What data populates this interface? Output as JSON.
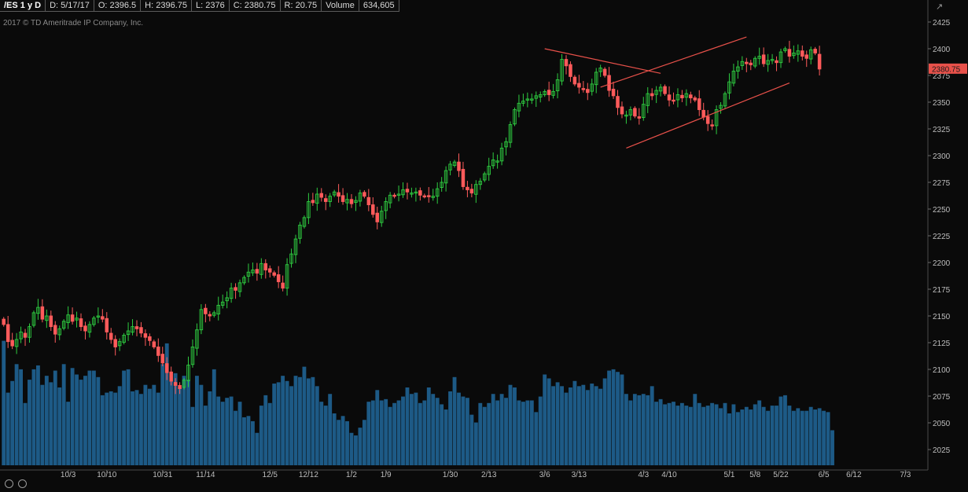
{
  "header": {
    "symbol": "/ES 1 y D",
    "date": "D: 5/17/17",
    "open": "O: 2396.5",
    "high": "H: 2396.75",
    "low": "L: 2376",
    "close": "C: 2380.75",
    "range": "R: 20.75",
    "volume_label": "Volume",
    "volume_value": "634,605"
  },
  "copyright": "2017 © TD Ameritrade IP Company, Inc.",
  "last_price_label": "2380.75",
  "colors": {
    "background": "#0a0a0a",
    "up": "#2ecc40",
    "down": "#ff5b5b",
    "volume": "#1d5a86",
    "trendline": "#e8514a",
    "price_badge": "#e8514a"
  },
  "chart_data": {
    "type": "candlestick",
    "y_ticks": [
      2025,
      2050,
      2075,
      2100,
      2125,
      2150,
      2175,
      2200,
      2225,
      2250,
      2275,
      2300,
      2325,
      2350,
      2375,
      2400,
      2425
    ],
    "ylim": [
      2015,
      2432
    ],
    "x_tick_labels": [
      "10/3",
      "10/10",
      "10/31",
      "11/14",
      "12/5",
      "12/12",
      "1/2",
      "1/9",
      "1/30",
      "2/13",
      "3/6",
      "3/13",
      "4/3",
      "4/10",
      "5/1",
      "5/8",
      "5/22",
      "6/5",
      "6/12",
      "7/3"
    ],
    "x_tick_bar_index": [
      15,
      24,
      37,
      47,
      62,
      71,
      81,
      89,
      104,
      113,
      126,
      134,
      149,
      155,
      169,
      175,
      181,
      191,
      198,
      210
    ],
    "closes": [
      2142,
      2126,
      2122,
      2128,
      2135,
      2130,
      2140,
      2153,
      2158,
      2147,
      2150,
      2140,
      2133,
      2138,
      2145,
      2151,
      2145,
      2148,
      2140,
      2136,
      2142,
      2148,
      2150,
      2147,
      2135,
      2128,
      2121,
      2126,
      2132,
      2136,
      2140,
      2138,
      2134,
      2130,
      2127,
      2121,
      2113,
      2106,
      2097,
      2089,
      2085,
      2082,
      2090,
      2104,
      2121,
      2137,
      2156,
      2152,
      2150,
      2153,
      2160,
      2163,
      2167,
      2176,
      2174,
      2181,
      2186,
      2191,
      2193,
      2190,
      2199,
      2193,
      2191,
      2188,
      2182,
      2176,
      2198,
      2208,
      2222,
      2235,
      2242,
      2257,
      2256,
      2264,
      2261,
      2257,
      2262,
      2266,
      2262,
      2257,
      2259,
      2255,
      2258,
      2265,
      2262,
      2254,
      2245,
      2238,
      2248,
      2257,
      2263,
      2262,
      2264,
      2268,
      2266,
      2265,
      2266,
      2263,
      2262,
      2262,
      2262,
      2269,
      2275,
      2286,
      2292,
      2294,
      2286,
      2271,
      2268,
      2265,
      2273,
      2276,
      2283,
      2290,
      2296,
      2295,
      2307,
      2313,
      2329,
      2343,
      2349,
      2351,
      2353,
      2353,
      2356,
      2357,
      2360,
      2357,
      2360,
      2371,
      2390,
      2384,
      2374,
      2367,
      2364,
      2362,
      2359,
      2367,
      2378,
      2382,
      2375,
      2361,
      2356,
      2345,
      2339,
      2338,
      2343,
      2337,
      2335,
      2348,
      2358,
      2356,
      2361,
      2364,
      2358,
      2352,
      2351,
      2357,
      2354,
      2358,
      2354,
      2352,
      2343,
      2336,
      2330,
      2328,
      2343,
      2347,
      2358,
      2369,
      2379,
      2383,
      2388,
      2386,
      2385,
      2391,
      2393,
      2386,
      2389,
      2390,
      2387,
      2397,
      2400,
      2393,
      2396,
      2398,
      2393,
      2391,
      2399,
      2396,
      2381
    ],
    "volumes": [
      96,
      56,
      65,
      78,
      74,
      48,
      66,
      74,
      77,
      62,
      69,
      64,
      73,
      60,
      78,
      49,
      75,
      70,
      66,
      69,
      73,
      73,
      68,
      54,
      56,
      57,
      56,
      61,
      73,
      74,
      57,
      58,
      55,
      62,
      59,
      62,
      56,
      78,
      94,
      65,
      71,
      60,
      69,
      66,
      45,
      69,
      62,
      46,
      57,
      74,
      53,
      49,
      52,
      53,
      42,
      49,
      37,
      38,
      34,
      25,
      46,
      54,
      48,
      63,
      64,
      69,
      65,
      61,
      69,
      68,
      76,
      67,
      68,
      61,
      49,
      46,
      55,
      40,
      35,
      38,
      34,
      25,
      23,
      29,
      35,
      49,
      50,
      58,
      50,
      51,
      45,
      48,
      50,
      53,
      60,
      55,
      56,
      48,
      50,
      60,
      55,
      52,
      47,
      43,
      57,
      68,
      56,
      53,
      52,
      39,
      33,
      48,
      45,
      48,
      55,
      50,
      55,
      52,
      62,
      60,
      50,
      49,
      50,
      50,
      41,
      53,
      70,
      67,
      61,
      64,
      61,
      56,
      60,
      65,
      61,
      62,
      58,
      63,
      61,
      59,
      67,
      73,
      74,
      72,
      70,
      55,
      50,
      55,
      54,
      55,
      54,
      61,
      49,
      51,
      47,
      48,
      49,
      46,
      48,
      46,
      45,
      55,
      48,
      45,
      46,
      48,
      47,
      44,
      48,
      40,
      47,
      41,
      43,
      45,
      43,
      47,
      50,
      45,
      42,
      46,
      46,
      53,
      54,
      46,
      42,
      44,
      42,
      42,
      45,
      43,
      44,
      42,
      41,
      27
    ],
    "volume_max": 100,
    "trendlines": [
      {
        "from": [
          126,
          2400
        ],
        "to": [
          153,
          2377
        ]
      },
      {
        "from": [
          139,
          2364
        ],
        "to": [
          173,
          2411
        ]
      },
      {
        "from": [
          145,
          2307
        ],
        "to": [
          183,
          2368
        ]
      }
    ],
    "grid": false
  }
}
